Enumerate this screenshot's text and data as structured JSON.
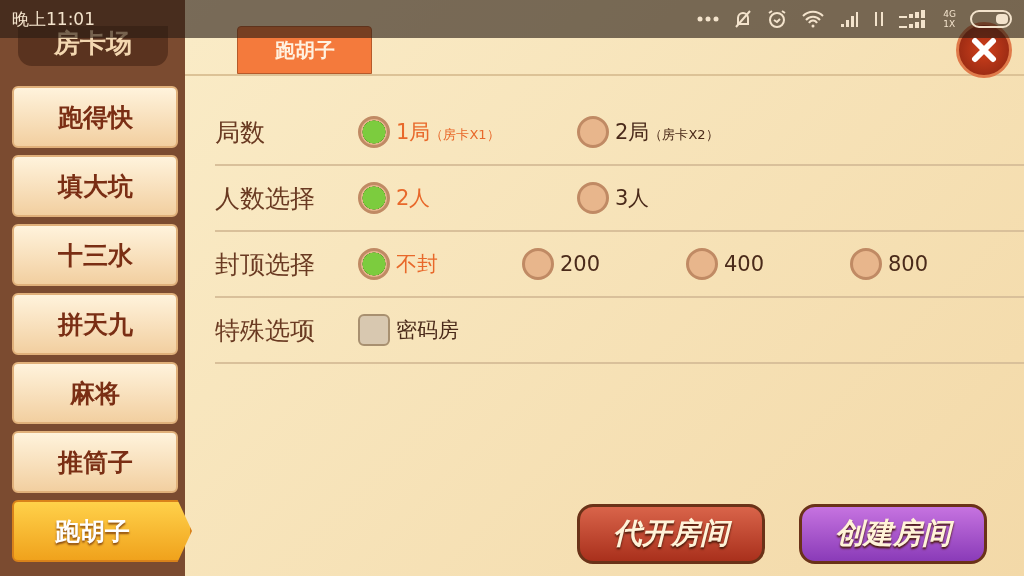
{
  "status_bar": {
    "time": "晚上11:01",
    "network": "4G",
    "network_sub": "1X"
  },
  "sidebar": {
    "title": "房卡场",
    "items": [
      {
        "label": "跑得快",
        "selected": false
      },
      {
        "label": "填大坑",
        "selected": false
      },
      {
        "label": "十三水",
        "selected": false
      },
      {
        "label": "拼天九",
        "selected": false
      },
      {
        "label": "麻将",
        "selected": false
      },
      {
        "label": "推筒子",
        "selected": false
      },
      {
        "label": "跑胡子",
        "selected": true
      }
    ]
  },
  "tabs": [
    {
      "label": "跑胡子",
      "selected": true
    }
  ],
  "options": [
    {
      "label": "局数",
      "kind": "radio",
      "choices": [
        {
          "label": "1局",
          "note": "（房卡X1）",
          "selected": true
        },
        {
          "label": "2局",
          "note": "（房卡X2）",
          "selected": false
        }
      ]
    },
    {
      "label": "人数选择",
      "kind": "radio",
      "choices": [
        {
          "label": "2人",
          "selected": true
        },
        {
          "label": "3人",
          "selected": false
        }
      ]
    },
    {
      "label": "封顶选择",
      "kind": "radio",
      "choices": [
        {
          "label": "不封",
          "selected": true
        },
        {
          "label": "200",
          "selected": false
        },
        {
          "label": "400",
          "selected": false
        },
        {
          "label": "800",
          "selected": false
        }
      ]
    },
    {
      "label": "特殊选项",
      "kind": "checkbox",
      "choices": [
        {
          "label": "密码房",
          "checked": false
        }
      ]
    }
  ],
  "buttons": [
    {
      "label": "代开房间",
      "kind": "proxy"
    },
    {
      "label": "创建房间",
      "kind": "create"
    }
  ]
}
